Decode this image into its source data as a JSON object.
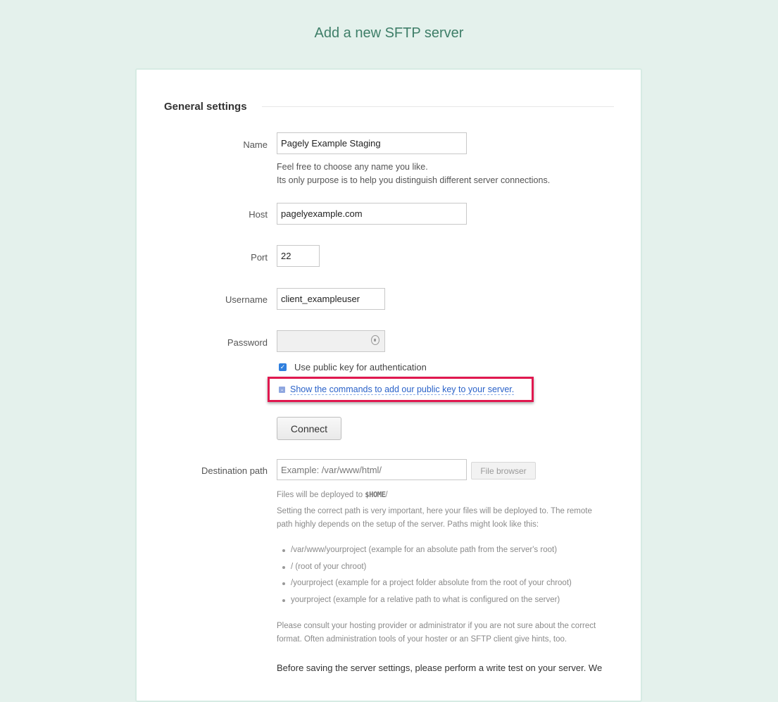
{
  "page": {
    "title": "Add a new SFTP server"
  },
  "section": {
    "heading": "General settings"
  },
  "form": {
    "name": {
      "label": "Name",
      "value": "Pagely Example Staging",
      "help_line1": "Feel free to choose any name you like.",
      "help_line2": "Its only purpose is to help you distinguish different server connections."
    },
    "host": {
      "label": "Host",
      "value": "pagelyexample.com"
    },
    "port": {
      "label": "Port",
      "value": "22"
    },
    "username": {
      "label": "Username",
      "value": "client_exampleuser"
    },
    "password": {
      "label": "Password",
      "value": "",
      "icon": "key-icon"
    },
    "public_key": {
      "label": "Use public key for authentication",
      "checked": true
    },
    "show_commands": {
      "label": "Show the commands to add our public key to your server.",
      "highlight_color": "#e0184f"
    },
    "connect_button": "Connect",
    "destination": {
      "label": "Destination path",
      "placeholder": "Example: /var/www/html/",
      "file_browser_button": "File browser",
      "deploy_prefix": "Files will be deployed to ",
      "deploy_var": "$HOME",
      "deploy_suffix": "/",
      "explanation": "Setting the correct path is very important, here your files will be deployed to. The remote path highly depends on the setup of the server. Paths might look like this:",
      "examples": [
        "/var/www/yourproject (example for an absolute path from the server's root)",
        "/ (root of your chroot)",
        "/yourproject (example for a project folder absolute from the root of your chroot)",
        "yourproject (example for a relative path to what is configured on the server)"
      ],
      "consult": "Please consult your hosting provider or administrator if you are not sure about the correct format. Often administration tools of your hoster or an SFTP client give hints, too.",
      "write_test": "Before saving the server settings, please perform a write test on your server. We"
    }
  },
  "colors": {
    "background": "#e4f1ec",
    "title": "#3e7e68",
    "link": "#2a62c9",
    "checkbox": "#2f7fde"
  }
}
